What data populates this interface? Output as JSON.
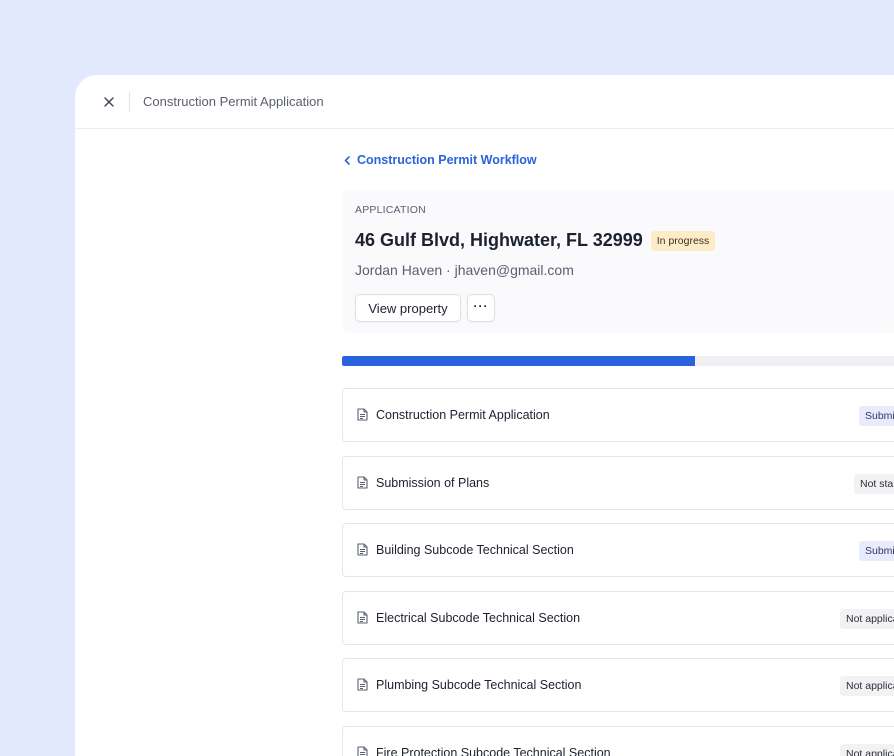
{
  "window": {
    "title": "Construction Permit Application",
    "close_label": "Close"
  },
  "breadcrumb": {
    "back_label": "Construction Permit Workflow"
  },
  "application": {
    "eyebrow": "APPLICATION",
    "address": "46 Gulf Blvd, Highwater, FL 32999",
    "status": "In progress",
    "owner": "Jordan Haven · jhaven@gmail.com",
    "view_property_label": "View property",
    "more_label": "···"
  },
  "progress": {
    "fraction": 0.57
  },
  "steps": [
    {
      "name": "Construction Permit Application",
      "status": "Submitted",
      "status_kind": "submitted"
    },
    {
      "name": "Submission of Plans",
      "status": "Not started",
      "status_kind": "notstarted"
    },
    {
      "name": "Building Subcode Technical Section",
      "status": "Submitted",
      "status_kind": "submitted"
    },
    {
      "name": "Electrical Subcode Technical Section",
      "status": "Not applicable",
      "status_kind": "na"
    },
    {
      "name": "Plumbing Subcode Technical Section",
      "status": "Not applicable",
      "status_kind": "na"
    },
    {
      "name": "Fire Protection Subcode Technical Section",
      "status": "Not applicable",
      "status_kind": "na"
    }
  ],
  "icons": {
    "close": "close-icon",
    "back": "chevron-left-icon",
    "document": "document-icon"
  },
  "colors": {
    "accent": "#2a62de",
    "background": "#e2e9fc",
    "in_progress_badge": "#fdecc8",
    "submitted_badge": "#e8ebfb"
  }
}
